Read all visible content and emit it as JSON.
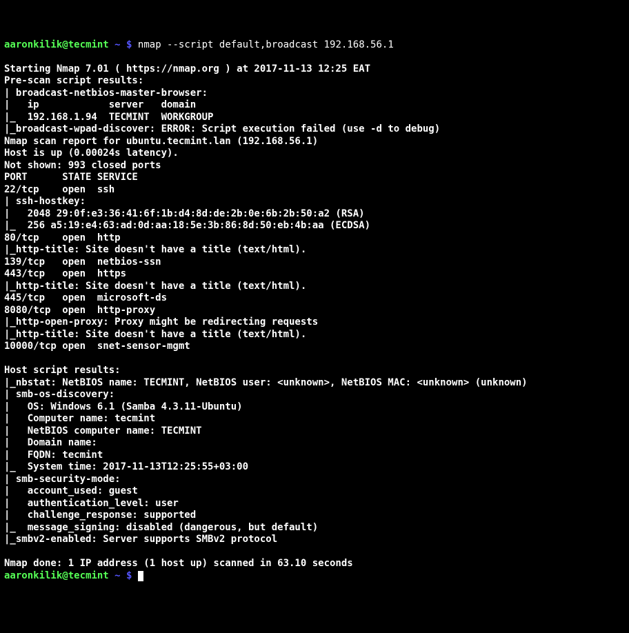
{
  "prompt1": {
    "user": "aaronkilik",
    "at": "@",
    "host": "tecmint",
    "path": " ~ $ ",
    "cmd": "nmap --script default,broadcast 192.168.56.1"
  },
  "output_lines": [
    "",
    "Starting Nmap 7.01 ( https://nmap.org ) at 2017-11-13 12:25 EAT",
    "Pre-scan script results:",
    "| broadcast-netbios-master-browser:",
    "|   ip            server   domain",
    "|_  192.168.1.94  TECMINT  WORKGROUP",
    "|_broadcast-wpad-discover: ERROR: Script execution failed (use -d to debug)",
    "Nmap scan report for ubuntu.tecmint.lan (192.168.56.1)",
    "Host is up (0.00024s latency).",
    "Not shown: 993 closed ports",
    "PORT      STATE SERVICE",
    "22/tcp    open  ssh",
    "| ssh-hostkey:",
    "|   2048 29:0f:e3:36:41:6f:1b:d4:8d:de:2b:0e:6b:2b:50:a2 (RSA)",
    "|_  256 a5:19:e4:63:ad:0d:aa:18:5e:3b:86:8d:50:eb:4b:aa (ECDSA)",
    "80/tcp    open  http",
    "|_http-title: Site doesn't have a title (text/html).",
    "139/tcp   open  netbios-ssn",
    "443/tcp   open  https",
    "|_http-title: Site doesn't have a title (text/html).",
    "445/tcp   open  microsoft-ds",
    "8080/tcp  open  http-proxy",
    "|_http-open-proxy: Proxy might be redirecting requests",
    "|_http-title: Site doesn't have a title (text/html).",
    "10000/tcp open  snet-sensor-mgmt",
    "",
    "Host script results:",
    "|_nbstat: NetBIOS name: TECMINT, NetBIOS user: <unknown>, NetBIOS MAC: <unknown> (unknown)",
    "| smb-os-discovery:",
    "|   OS: Windows 6.1 (Samba 4.3.11-Ubuntu)",
    "|   Computer name: tecmint",
    "|   NetBIOS computer name: TECMINT",
    "|   Domain name:",
    "|   FQDN: tecmint",
    "|_  System time: 2017-11-13T12:25:55+03:00",
    "| smb-security-mode:",
    "|   account_used: guest",
    "|   authentication_level: user",
    "|   challenge_response: supported",
    "|_  message_signing: disabled (dangerous, but default)",
    "|_smbv2-enabled: Server supports SMBv2 protocol",
    "",
    "Nmap done: 1 IP address (1 host up) scanned in 63.10 seconds"
  ],
  "prompt2": {
    "user": "aaronkilik",
    "at": "@",
    "host": "tecmint",
    "path": " ~ $ "
  }
}
